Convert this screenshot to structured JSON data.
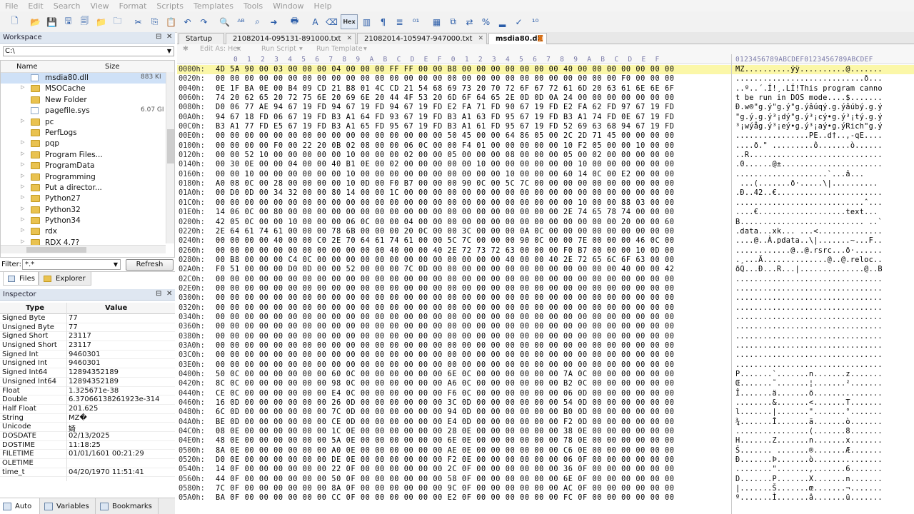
{
  "menu": [
    "File",
    "Edit",
    "Search",
    "View",
    "Format",
    "Scripts",
    "Templates",
    "Tools",
    "Window",
    "Help"
  ],
  "toolbar": {
    "icons": [
      "new-file-icon",
      "open-folder-icon",
      "save-icon",
      "save-as-icon",
      "save-all-icon",
      "open-file-icon",
      "folder-icon",
      "cut-icon",
      "copy-icon",
      "paste-icon",
      "undo-icon",
      "redo-icon",
      "find-icon",
      "replace-icon",
      "find-in-files-icon",
      "goto-icon",
      "print-icon",
      "font-icon",
      "color-icon",
      "hex-mode-icon",
      "columns-icon",
      "paragraph-icon",
      "align-icon",
      "binary-icon",
      "calculator-icon",
      "compare-icon",
      "swap-icon",
      "percent-icon",
      "histogram-icon",
      "checksum-icon",
      "base-convert-icon"
    ],
    "hex_label": "Hex"
  },
  "workspace": {
    "title": "Workspace",
    "path": "C:\\",
    "col_name": "Name",
    "col_size": "Size",
    "items": [
      {
        "name": "msdia80.dll",
        "type": "file",
        "size": "883 KI",
        "selected": true,
        "exp": ""
      },
      {
        "name": "MSOCache",
        "type": "folder",
        "size": "",
        "exp": "▷"
      },
      {
        "name": "New Folder",
        "type": "folder",
        "size": "",
        "exp": ""
      },
      {
        "name": "pagefile.sys",
        "type": "file",
        "size": "6.07 GI",
        "exp": ""
      },
      {
        "name": "pc",
        "type": "folder",
        "size": "",
        "exp": "▷"
      },
      {
        "name": "PerfLogs",
        "type": "folder",
        "size": "",
        "exp": ""
      },
      {
        "name": "pqp",
        "type": "folder",
        "size": "",
        "exp": "▷"
      },
      {
        "name": "Program Files...",
        "type": "folder",
        "size": "",
        "exp": "▷"
      },
      {
        "name": "ProgramData",
        "type": "folder",
        "size": "",
        "exp": "▷"
      },
      {
        "name": "Programming",
        "type": "folder",
        "size": "",
        "exp": "▷"
      },
      {
        "name": "Put a director...",
        "type": "folder",
        "size": "",
        "exp": "▷"
      },
      {
        "name": "Python27",
        "type": "folder",
        "size": "",
        "exp": "▷"
      },
      {
        "name": "Python32",
        "type": "folder",
        "size": "",
        "exp": "▷"
      },
      {
        "name": "Python34",
        "type": "folder",
        "size": "",
        "exp": "▷"
      },
      {
        "name": "rdx",
        "type": "folder",
        "size": "",
        "exp": "▷"
      },
      {
        "name": "RDX 4.7?",
        "type": "folder",
        "size": "",
        "exp": "▷"
      }
    ],
    "filter_label": "Filter:",
    "filter_value": "*.*",
    "refresh_label": "Refresh",
    "tabs": [
      "Files",
      "Explorer"
    ]
  },
  "inspector": {
    "title": "Inspector",
    "col_type": "Type",
    "col_value": "Value",
    "rows": [
      {
        "type": "Signed Byte",
        "value": "77"
      },
      {
        "type": "Unsigned Byte",
        "value": "77"
      },
      {
        "type": "Signed Short",
        "value": "23117"
      },
      {
        "type": "Unsigned Short",
        "value": "23117"
      },
      {
        "type": "Signed Int",
        "value": "9460301"
      },
      {
        "type": "Unsigned Int",
        "value": "9460301"
      },
      {
        "type": "Signed Int64",
        "value": "12894352189"
      },
      {
        "type": "Unsigned Int64",
        "value": "12894352189"
      },
      {
        "type": "Float",
        "value": "1.325671e-38"
      },
      {
        "type": "Double",
        "value": "6.37066138261923e-314"
      },
      {
        "type": "Half Float",
        "value": "201.625"
      },
      {
        "type": "String",
        "value": "MZ�"
      },
      {
        "type": "Unicode",
        "value": "婍"
      },
      {
        "type": "DOSDATE",
        "value": "02/13/2025"
      },
      {
        "type": "DOSTIME",
        "value": "11:18:25"
      },
      {
        "type": "FILETIME",
        "value": "01/01/1601 00:21:29"
      },
      {
        "type": "OLETIME",
        "value": ""
      },
      {
        "type": "time_t",
        "value": "04/20/1970 11:51:41"
      }
    ]
  },
  "bottom_tabs": [
    "Auto",
    "Variables",
    "Bookmarks"
  ],
  "doc_tabs": [
    {
      "label": "Startup",
      "active": false
    },
    {
      "label": "21082014-095131-891000.txt",
      "active": false
    },
    {
      "label": "21082014-105947-947000.txt",
      "active": false
    },
    {
      "label": "msdia80.dll",
      "active": true
    }
  ],
  "editbar": {
    "edit_as": "Edit As: Hex",
    "run_script": "Run Script",
    "run_template": "Run Template"
  },
  "column_header": {
    "hex": "0  1  2  3  4  5  6  7  8  9  A  B  C  D  E  F  0  1  2  3  4  5  6  7  8  9  A  B  C  D  E  F",
    "ascii": "0123456789ABCDEF0123456789ABCDEF"
  },
  "hex_rows": [
    {
      "addr": "0000h:",
      "hex": "4D 5A 90 00 03 00 00 00 04 00 00 00 FF FF 00 00 B8 00 00 00 00 00 00 00 40 00 00 00 00 00 00 00",
      "ascii": "MZ..........ÿÿ..........@.......",
      "hl": true
    },
    {
      "addr": "0020h:",
      "hex": "00 00 00 00 00 00 00 00 00 00 00 00 00 00 00 00 00 00 00 00 00 00 00 00 00 00 00 00 F0 00 00 00",
      "ascii": "............................ð..."
    },
    {
      "addr": "0040h:",
      "hex": "0E 1F BA 0E 00 B4 09 CD 21 B8 01 4C CD 21 54 68 69 73 20 70 72 6F 67 72 61 6D 20 63 61 6E 6E 6F",
      "ascii": "..º..´.Í!¸.LÍ!This program canno"
    },
    {
      "addr": "0060h:",
      "hex": "74 20 62 65 20 72 75 6E 20 69 6E 20 44 4F 53 20 6D 6F 64 65 2E 0D 0D 0A 24 00 00 00 00 00 00 00",
      "ascii": "t be run in DOS mode....$......."
    },
    {
      "addr": "0080h:",
      "hex": "D0 06 77 AE 94 67 19 FD 94 67 19 FD 94 67 19 FD E2 FA 71 FD 90 67 19 FD E2 FA 62 FD 97 67 19 FD",
      "ascii": "Ð.w®\"g.ý\"g.ý\"g.ýâúqý.g.ýâúbý.g.ý"
    },
    {
      "addr": "00A0h:",
      "hex": "94 67 18 FD 06 67 19 FD B3 A1 64 FD 93 67 19 FD B3 A1 63 FD 95 67 19 FD B3 A1 74 FD 0E 67 19 FD",
      "ascii": "\"g.ý.g.ý³¡dý\"g.ý³¡cý•g.ý³¡tý.g.ý"
    },
    {
      "addr": "00C0h:",
      "hex": "B3 A1 77 FD E5 67 19 FD B3 A1 65 FD 95 67 19 FD B3 A1 61 FD 95 67 19 FD 52 69 63 68 94 67 19 FD",
      "ascii": "³¡wýåg.ý³¡eý•g.ý³¡aý•g.ýRich\"g.ý"
    },
    {
      "addr": "00E0h:",
      "hex": "00 00 00 00 00 00 00 00 00 00 00 00 00 00 00 00 50 45 00 00 64 86 05 00 2C 2D 71 45 00 00 00 00",
      "ascii": "................PE..d†..,-qE...."
    },
    {
      "addr": "0100h:",
      "hex": "00 00 00 00 F0 00 22 20 0B 02 08 00 00 06 0C 00 00 F4 01 00 00 00 00 00 10 F2 05 00 00 10 00 00",
      "ascii": "....ð.\" .........ô.......ò......"
    },
    {
      "addr": "0120h:",
      "hex": "00 00 52 10 00 00 00 00 00 10 00 00 00 02 00 00 05 00 00 00 08 00 00 00 05 00 02 00 00 00 00 00",
      "ascii": "..R............................."
    },
    {
      "addr": "0140h:",
      "hex": "00 30 0E 00 00 04 00 00 40 B1 0E 00 02 00 00 00 00 00 10 00 00 00 00 00 00 10 00 00 00 00 00 00",
      "ascii": ".0......@±......................"
    },
    {
      "addr": "0160h:",
      "hex": "00 00 10 00 00 00 00 00 00 10 00 00 00 00 00 00 00 00 00 00 10 00 00 00 60 14 0C 00 E2 00 00 00",
      "ascii": "....................`...â..."
    },
    {
      "addr": "0180h:",
      "hex": "A0 08 0C 00 28 00 00 00 00 10 0D 00 F0 B7 00 00 00 90 0C 00 5C 7C 00 00 00 00 00 00 00 00 00 00",
      "ascii": " ...(.......ð·.....\\|.........."
    },
    {
      "addr": "01A0h:",
      "hex": "00 D0 0D 00 34 32 00 00 80 14 00 00 1C 00 00 00 00 00 00 00 00 00 00 00 00 00 00 00 00 00 00 00",
      "ascii": ".Ð..42..€......................."
    },
    {
      "addr": "01C0h:",
      "hex": "00 00 00 00 00 00 00 00 00 00 00 00 00 00 00 00 00 00 00 00 00 00 00 00 00 10 00 00 88 03 00 00",
      "ascii": "............................ˆ..."
    },
    {
      "addr": "01E0h:",
      "hex": "14 06 0C 00 80 00 00 00 00 00 00 00 00 00 00 00 00 00 00 00 00 00 00 00 2E 74 65 78 74 00 00 00",
      "ascii": "....€...................text..."
    },
    {
      "addr": "0200h:",
      "hex": "42 05 0C 00 00 10 00 00 00 06 0C 00 00 04 00 00 00 00 00 00 00 00 00 00 00 00 00 00 20 00 00 60",
      "ascii": "B........................... ..`"
    },
    {
      "addr": "0220h:",
      "hex": "2E 64 61 74 61 00 00 00 78 6B 00 00 00 20 0C 00 00 3C 00 00 00 0A 0C 00 00 00 00 00 00 00 00 00",
      "ascii": ".data...xk... ...<.............."
    },
    {
      "addr": "0240h:",
      "hex": "00 00 00 00 40 00 00 C0 2E 70 64 61 74 61 00 00 5C 7C 00 00 00 90 0C 00 00 7E 00 00 00 46 0C 00",
      "ascii": "....@..À.pdata..\\|.......~...F.."
    },
    {
      "addr": "0260h:",
      "hex": "00 00 00 00 00 00 00 00 00 00 00 00 40 00 00 40 2E 72 73 72 63 00 00 00 F0 B7 00 00 00 10 0D 00",
      "ascii": "............@..@.rsrc...ð·......"
    },
    {
      "addr": "0280h:",
      "hex": "00 B8 00 00 00 C4 0C 00 00 00 00 00 00 00 00 00 00 00 00 00 40 00 00 40 2E 72 65 6C 6F 63 00 00",
      "ascii": ".¸...Ä..............@..@.reloc.."
    },
    {
      "addr": "02A0h:",
      "hex": "F0 51 00 00 00 D0 0D 00 00 52 00 00 00 7C 0D 00 00 00 00 00 00 00 00 00 00 00 00 00 40 00 00 42",
      "ascii": "ðQ...Ð...R...|..............@..B"
    },
    {
      "addr": "02C0h:",
      "hex": "00 00 00 00 00 00 00 00 00 00 00 00 00 00 00 00 00 00 00 00 00 00 00 00 00 00 00 00 00 00 00 00",
      "ascii": "................................"
    },
    {
      "addr": "02E0h:",
      "hex": "00 00 00 00 00 00 00 00 00 00 00 00 00 00 00 00 00 00 00 00 00 00 00 00 00 00 00 00 00 00 00 00",
      "ascii": "................................"
    },
    {
      "addr": "0300h:",
      "hex": "00 00 00 00 00 00 00 00 00 00 00 00 00 00 00 00 00 00 00 00 00 00 00 00 00 00 00 00 00 00 00 00",
      "ascii": "................................"
    },
    {
      "addr": "0320h:",
      "hex": "00 00 00 00 00 00 00 00 00 00 00 00 00 00 00 00 00 00 00 00 00 00 00 00 00 00 00 00 00 00 00 00",
      "ascii": "................................"
    },
    {
      "addr": "0340h:",
      "hex": "00 00 00 00 00 00 00 00 00 00 00 00 00 00 00 00 00 00 00 00 00 00 00 00 00 00 00 00 00 00 00 00",
      "ascii": "................................"
    },
    {
      "addr": "0360h:",
      "hex": "00 00 00 00 00 00 00 00 00 00 00 00 00 00 00 00 00 00 00 00 00 00 00 00 00 00 00 00 00 00 00 00",
      "ascii": "................................"
    },
    {
      "addr": "0380h:",
      "hex": "00 00 00 00 00 00 00 00 00 00 00 00 00 00 00 00 00 00 00 00 00 00 00 00 00 00 00 00 00 00 00 00",
      "ascii": "................................"
    },
    {
      "addr": "03A0h:",
      "hex": "00 00 00 00 00 00 00 00 00 00 00 00 00 00 00 00 00 00 00 00 00 00 00 00 00 00 00 00 00 00 00 00",
      "ascii": "................................"
    },
    {
      "addr": "03C0h:",
      "hex": "00 00 00 00 00 00 00 00 00 00 00 00 00 00 00 00 00 00 00 00 00 00 00 00 00 00 00 00 00 00 00 00",
      "ascii": "................................"
    },
    {
      "addr": "03E0h:",
      "hex": "00 00 00 00 00 00 00 00 00 00 00 00 00 00 00 00 00 00 00 00 00 00 00 00 00 00 00 00 00 00 00 00",
      "ascii": "................................"
    },
    {
      "addr": "0400h:",
      "hex": "50 0C 00 00 00 00 00 00 60 0C 00 00 00 00 00 00 6E 0C 00 00 00 00 00 00 7A 0C 00 00 00 00 00 00",
      "ascii": "P.......`.......n.......z......."
    },
    {
      "addr": "0420h:",
      "hex": "8C 0C 00 00 00 00 00 00 98 0C 00 00 00 00 00 00 A6 0C 00 00 00 00 00 00 B2 0C 00 00 00 00 00 00",
      "ascii": "Œ.......˜.......¦.......²......."
    },
    {
      "addr": "0440h:",
      "hex": "CE 0C 00 00 00 00 00 00 E4 0C 00 00 00 00 00 00 F6 0C 00 00 00 00 00 00 06 0D 00 00 00 00 00 00",
      "ascii": "Î.......ä.......ö..............."
    },
    {
      "addr": "0460h:",
      "hex": "16 0D 00 00 00 00 00 00 26 0D 00 00 00 00 00 00 3C 0D 00 00 00 00 00 00 54 0D 00 00 00 00 00 00",
      "ascii": "........&.......<.......T......."
    },
    {
      "addr": "0480h:",
      "hex": "6C 0D 00 00 00 00 00 00 7C 0D 00 00 00 00 00 00 94 0D 00 00 00 00 00 00 B0 0D 00 00 00 00 00 00",
      "ascii": "l.......|.......\".......°......."
    },
    {
      "addr": "04A0h:",
      "hex": "BE 0D 00 00 00 00 00 00 CE 0D 00 00 00 00 00 00 E4 0D 00 00 00 00 00 00 F2 0D 00 00 00 00 00 00",
      "ascii": "¾.......Î.......ä.......ò......."
    },
    {
      "addr": "04C0h:",
      "hex": "08 0E 00 00 00 00 00 00 1C 0E 00 00 00 00 00 00 28 0E 00 00 00 00 00 00 38 0E 00 00 00 00 00 00",
      "ascii": "................(.......8......."
    },
    {
      "addr": "04E0h:",
      "hex": "48 0E 00 00 00 00 00 00 5A 0E 00 00 00 00 00 00 6E 0E 00 00 00 00 00 00 78 0E 00 00 00 00 00 00",
      "ascii": "H.......Z.......n.......x......."
    },
    {
      "addr": "0500h:",
      "hex": "8A 0E 00 00 00 00 00 00 A0 0E 00 00 00 00 00 00 AE 0E 00 00 00 00 00 00 C6 0E 00 00 00 00 00 00",
      "ascii": "Š....... .......®.......Æ......."
    },
    {
      "addr": "0520h:",
      "hex": "D0 0E 00 00 00 00 00 00 DE 0E 00 00 00 00 00 00 F2 0E 00 00 00 00 00 00 06 0F 00 00 00 00 00 00",
      "ascii": "Ð.......Þ.......ò..............."
    },
    {
      "addr": "0540h:",
      "hex": "14 0F 00 00 00 00 00 00 22 0F 00 00 00 00 00 00 2C 0F 00 00 00 00 00 00 36 0F 00 00 00 00 00 00",
      "ascii": "........\".......,.......6......."
    },
    {
      "addr": "0560h:",
      "hex": "44 0F 00 00 00 00 00 00 50 0F 00 00 00 00 00 00 58 0F 00 00 00 00 00 00 6E 0F 00 00 00 00 00 00",
      "ascii": "D.......P.......X.......n......."
    },
    {
      "addr": "0580h:",
      "hex": "7C 0F 00 00 00 00 00 00 8A 0F 00 00 00 00 00 00 9C 0F 00 00 00 00 00 00 AC 0F 00 00 00 00 00 00",
      "ascii": "|.......Š.......œ.......¬......."
    },
    {
      "addr": "05A0h:",
      "hex": "BA 0F 00 00 00 00 00 00 CC 0F 00 00 00 00 00 00 E2 0F 00 00 00 00 00 00 FC 0F 00 00 00 00 00 00",
      "ascii": "º.......Ì.......â.......ü......."
    }
  ]
}
